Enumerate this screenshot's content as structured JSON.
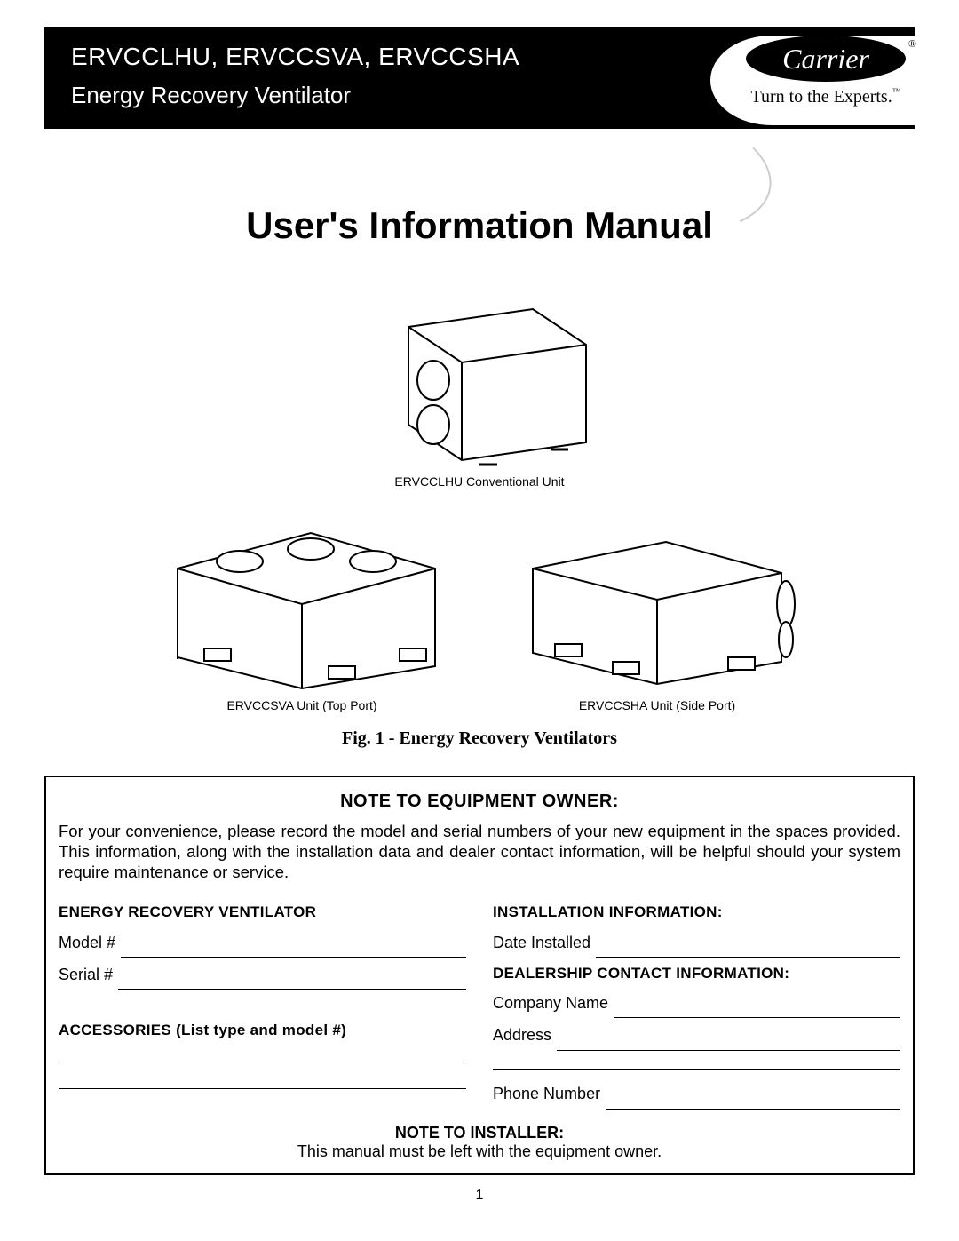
{
  "header": {
    "models": "ERVCCLHU, ERVCCSVA, ERVCCSHA",
    "subtitle": "Energy Recovery Ventilator",
    "brand": "Carrier",
    "tagline": "Turn to the Experts."
  },
  "title": "User's Information Manual",
  "figures": {
    "unit1_caption": "ERVCCLHU Conventional Unit",
    "unit2_caption": "ERVCCSVA Unit (Top Port)",
    "unit3_caption": "ERVCCSHA Unit (Side Port)",
    "main_caption": "Fig. 1 - Energy Recovery Ventilators"
  },
  "note": {
    "title": "NOTE TO EQUIPMENT OWNER:",
    "text": "For your convenience, please record the model and serial numbers of your new equipment in the spaces provided. This information, along with the installation data and dealer contact information, will be helpful should your system require maintenance or service.",
    "left": {
      "heading1": "ENERGY RECOVERY VENTILATOR",
      "model_label": "Model #",
      "serial_label": "Serial #",
      "heading2": "ACCESSORIES (List type and model #)"
    },
    "right": {
      "heading1": "INSTALLATION INFORMATION:",
      "date_label": "Date Installed",
      "heading2": "DEALERSHIP CONTACT INFORMATION:",
      "company_label": "Company Name",
      "address_label": "Address",
      "phone_label": "Phone Number"
    },
    "installer_heading": "NOTE TO INSTALLER:",
    "installer_text": "This manual must be left with the equipment owner."
  },
  "page_number": "1"
}
